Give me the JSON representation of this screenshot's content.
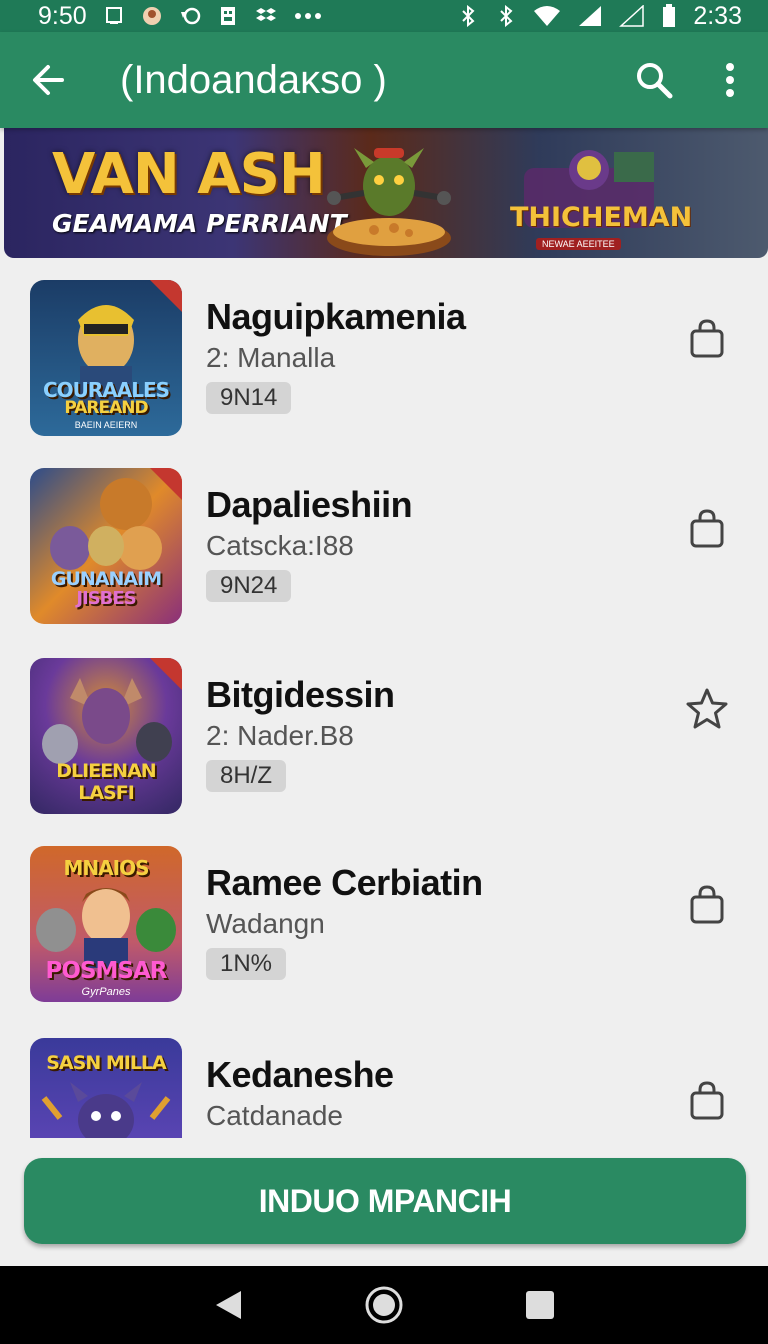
{
  "status_bar": {
    "time_left": "9:50",
    "time_right": "2:33",
    "left_icons": [
      "square-icon",
      "avatar-icon",
      "sync-icon",
      "sim-icon",
      "more-dots-icon"
    ],
    "right_icons": [
      "bluetooth-icon",
      "bluetooth-icon",
      "wifi-icon",
      "signal-icon",
      "signal-icon",
      "battery-icon"
    ]
  },
  "app_bar": {
    "title": "(Indoandaĸso )"
  },
  "banner": {
    "title": "VAN ASH",
    "subtitle": "GEAMAMA PERRIANT",
    "right_title": "THICHEMAN",
    "right_sub": "NEWAE AEEITEE"
  },
  "items": [
    {
      "title": "Naguipkamenia",
      "subtitle": "2: Manalla",
      "badge": "9N14",
      "action_icon": "shopping-bag-icon",
      "thumb_label": "COURAALES",
      "thumb_label2": "PAREAND",
      "thumb_sub": "BAEIN AEIERN",
      "colors": [
        "#1b3c66",
        "#2d6a9a",
        "#c4372f"
      ]
    },
    {
      "title": "Dapalieshiin",
      "subtitle": "Catscka:I88",
      "badge": "9N24",
      "action_icon": "shopping-bag-icon",
      "thumb_label": "GUNANAIM",
      "thumb_label2": "JISBES",
      "thumb_sub": "",
      "colors": [
        "#2d4c8a",
        "#e08a2a",
        "#8a2f7a"
      ]
    },
    {
      "title": "Bitgidessin",
      "subtitle": "2: Nader.B8",
      "badge": "8H/Z",
      "action_icon": "star-icon",
      "thumb_label": "DLIEENAN",
      "thumb_label2": "LASFI",
      "thumb_sub": "",
      "colors": [
        "#3a2a6a",
        "#6a3a9a",
        "#d08a3a"
      ]
    },
    {
      "title": "Ramee Cerbiatin",
      "subtitle": "Wadangn",
      "badge": "1N%",
      "action_icon": "shopping-bag-icon",
      "thumb_label": "MNAIOS",
      "thumb_label2": "POSMSAR",
      "thumb_sub": "GyrPanes",
      "colors": [
        "#d0682a",
        "#7a3a9a",
        "#2a8a4a"
      ]
    },
    {
      "title": "Kedaneshe",
      "subtitle": "Catdanade",
      "badge": "",
      "action_icon": "shopping-bag-icon",
      "thumb_label": "SASN MILLA",
      "thumb_label2": "",
      "thumb_sub": "",
      "colors": [
        "#3a3a9a",
        "#6a4ac0",
        "#e0a030"
      ]
    }
  ],
  "cta": {
    "label": "INDUO MPANCIH"
  },
  "colors": {
    "primary": "#2a8a62",
    "status_bar": "#1f7a57",
    "background": "#efefef"
  }
}
